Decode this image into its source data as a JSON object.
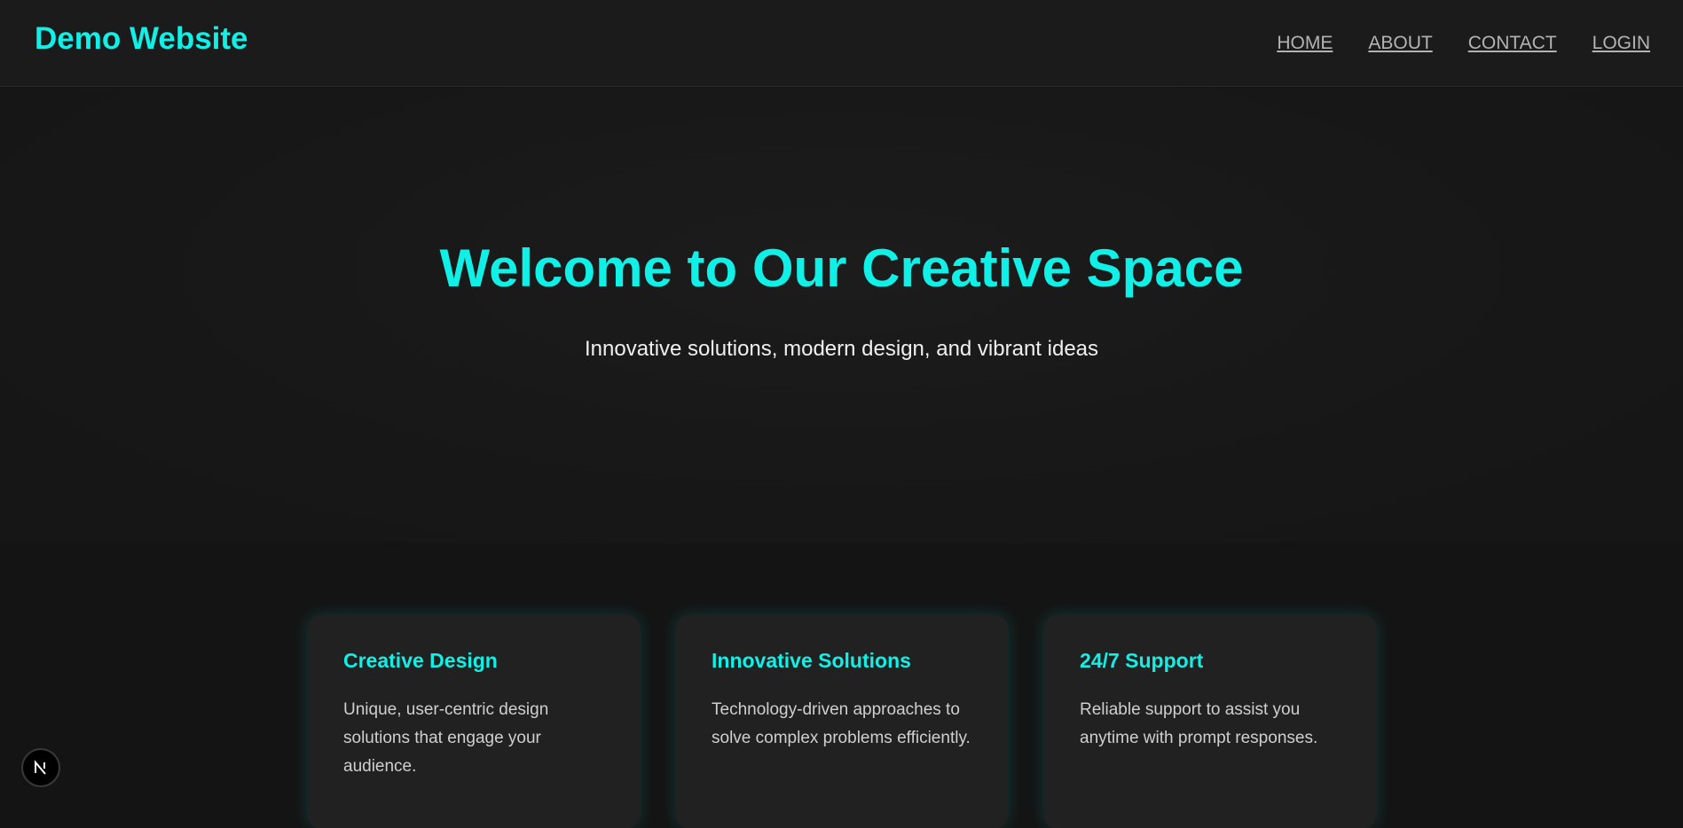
{
  "header": {
    "brand": "Demo Website",
    "nav": [
      {
        "label": "HOME"
      },
      {
        "label": "ABOUT"
      },
      {
        "label": "CONTACT"
      },
      {
        "label": "LOGIN"
      }
    ]
  },
  "hero": {
    "title": "Welcome to Our Creative Space",
    "subtitle": "Innovative solutions, modern design, and vibrant ideas"
  },
  "features": [
    {
      "title": "Creative Design",
      "description": "Unique, user-centric design solutions that engage your audience."
    },
    {
      "title": "Innovative Solutions",
      "description": "Technology-driven approaches to solve complex problems efficiently."
    },
    {
      "title": "24/7 Support",
      "description": "Reliable support to assist you anytime with prompt responses."
    }
  ],
  "dev_badge": {
    "icon": "nextjs-logo-icon"
  },
  "colors": {
    "accent": "#11f0e6",
    "background": "#141414",
    "header_bg": "#1b1b1b",
    "card_bg": "#212121",
    "nav_text": "#b3b3b3"
  }
}
